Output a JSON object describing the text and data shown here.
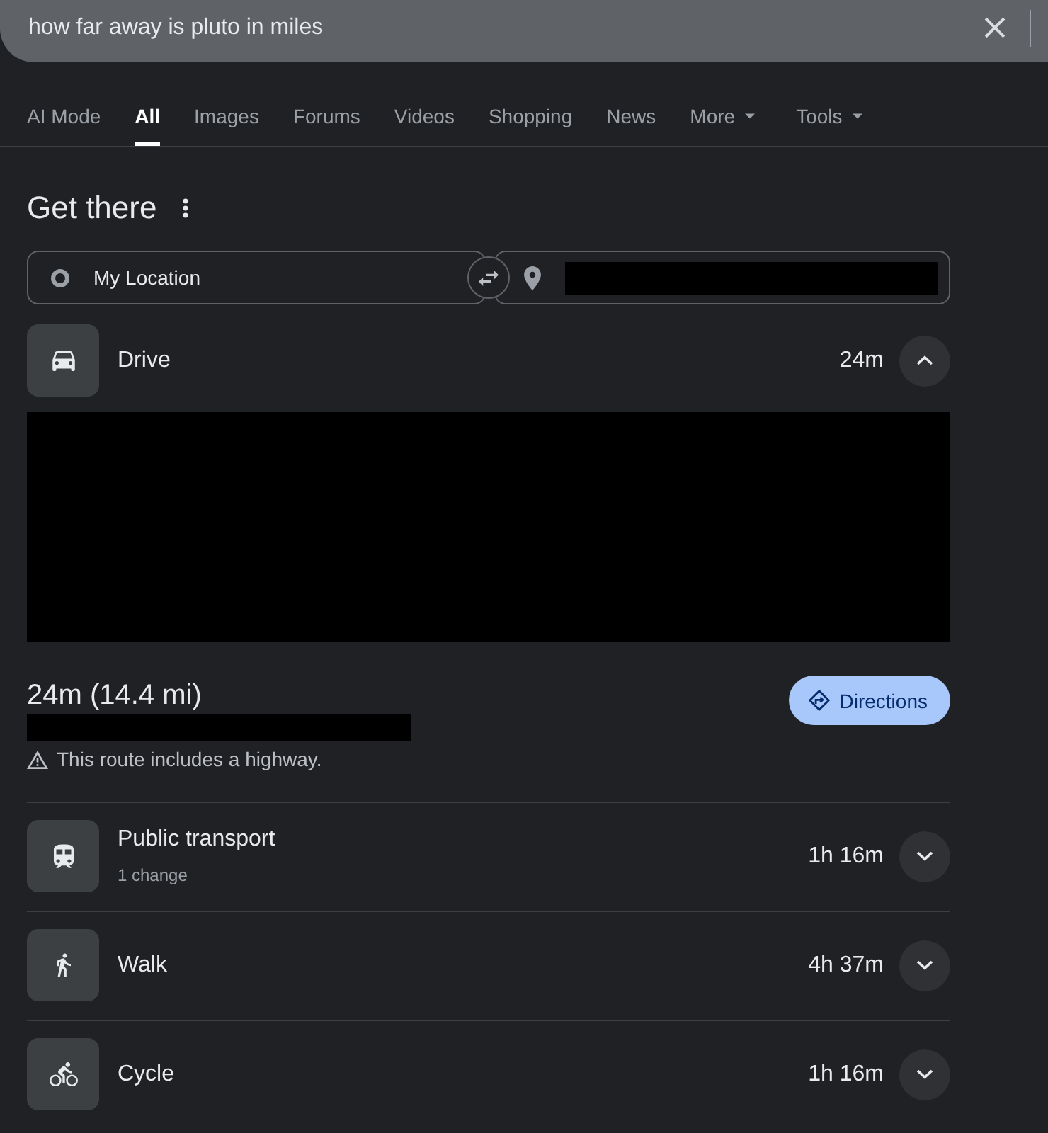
{
  "search": {
    "query": "how far away is pluto in miles"
  },
  "tabs": [
    {
      "label": "AI Mode",
      "selected": false,
      "dropdown": false
    },
    {
      "label": "All",
      "selected": true,
      "dropdown": false
    },
    {
      "label": "Images",
      "selected": false,
      "dropdown": false
    },
    {
      "label": "Forums",
      "selected": false,
      "dropdown": false
    },
    {
      "label": "Videos",
      "selected": false,
      "dropdown": false
    },
    {
      "label": "Shopping",
      "selected": false,
      "dropdown": false
    },
    {
      "label": "News",
      "selected": false,
      "dropdown": false
    },
    {
      "label": "More",
      "selected": false,
      "dropdown": true
    },
    {
      "label": "Tools",
      "selected": false,
      "dropdown": true
    }
  ],
  "get_there": {
    "title": "Get there",
    "origin": {
      "value": "My Location"
    }
  },
  "modes": [
    {
      "kind": "drive",
      "label": "Drive",
      "time": "24m",
      "expanded": true,
      "route": {
        "summary": "24m (14.4 mi)",
        "warning": "This route includes a highway.",
        "button": "Directions"
      }
    },
    {
      "kind": "transit",
      "label": "Public transport",
      "detail": "1 change",
      "time": "1h 16m",
      "expanded": false
    },
    {
      "kind": "walk",
      "label": "Walk",
      "time": "4h 37m",
      "expanded": false
    },
    {
      "kind": "cycle",
      "label": "Cycle",
      "time": "1h 16m",
      "expanded": false
    }
  ]
}
